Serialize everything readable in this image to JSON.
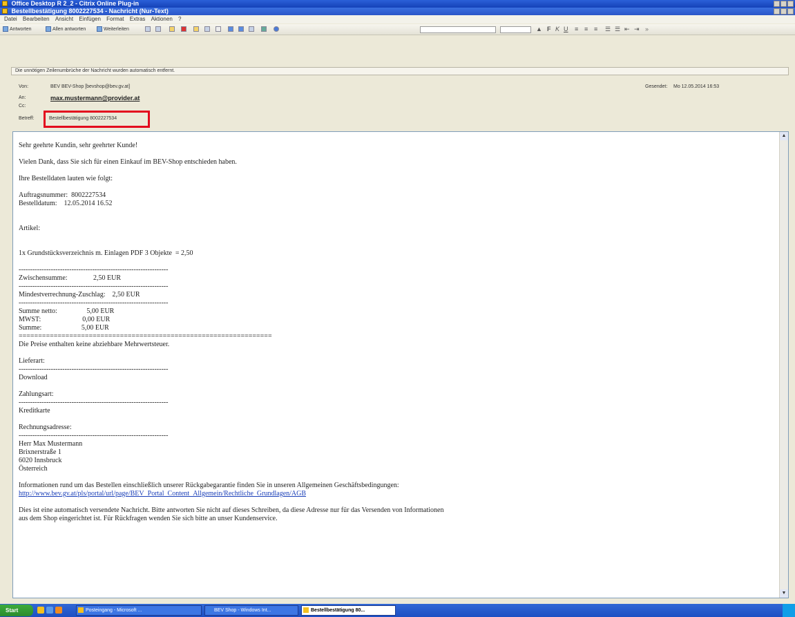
{
  "outer_window": {
    "title": "Office Desktop R 2_2 - Citrix Online Plug-in"
  },
  "message_window": {
    "title": "Bestellbestätigung 8002227534 - Nachricht (Nur-Text)"
  },
  "menu": [
    "Datei",
    "Bearbeiten",
    "Ansicht",
    "Einfügen",
    "Format",
    "Extras",
    "Aktionen",
    "?"
  ],
  "toolbar": {
    "reply": "Antworten",
    "reply_all": "Allen antworten",
    "forward": "Weiterleiten"
  },
  "info_bar": "Die unnötigen Zeilenumbrüche der Nachricht wurden automatisch entfernt.",
  "header": {
    "from_label": "Von:",
    "from_value": "BEV BEV-Shop [bevshop@bev.gv.at]",
    "to_label": "An:",
    "to_value": "max.mustermann@provider.at",
    "cc_label": "Cc:",
    "subject_label": "Betreff:",
    "subject_value": "Bestellbestätigung 8002227534",
    "sent_label": "Gesendet:",
    "sent_value": "Mo 12.05.2014 16:53"
  },
  "body": {
    "greeting": "Sehr geehrte Kundin, sehr geehrter Kunde!",
    "thanks": "Vielen Dank, dass Sie sich für einen Einkauf im BEV-Shop entschieden haben.",
    "intro": "Ihre Bestelldaten lauten wie folgt:",
    "order_number": "Auftragsnummer:  8002227534",
    "order_date": "Bestelldatum:    12.05.2014 16.52",
    "articles_heading": "Artikel:",
    "article_line": "1x Grundstücksverzeichnis m. Einlagen PDF 3 Objekte  = 2,50",
    "divider": "-----------------------------------------------------------------",
    "subtotal": "Zwischensumme:               2,50 EUR",
    "min_charge": "Mindestverrechnung-Zuschlag:    2,50 EUR",
    "net_sum": "Summe netto:                 5,00 EUR",
    "vat": "MWST:                        0,00 EUR",
    "total": "Summe:                       5,00 EUR",
    "double_divider": "=================================================================",
    "vat_note": "Die Preise enthalten keine abziehbare Mehrwertsteuer.",
    "delivery_label": "Lieferart:",
    "delivery_value": "Download",
    "payment_label": "Zahlungsart:",
    "payment_value": "Kreditkarte",
    "billing_label": "Rechnungsadresse:",
    "address_name": "Herr Max Mustermann",
    "address_street": "Brixnerstraße 1",
    "address_city": "6020 Innsbruck",
    "address_country": "Österreich",
    "terms_text": "Informationen rund um das Bestellen einschließlich unserer Rückgabegarantie finden Sie in unseren Allgemeinen Geschäftsbedingungen:",
    "terms_link": "http://www.bev.gv.at/pls/portal/url/page/BEV_Portal_Content_Allgemein/Rechtliche_Grundlagen/AGB",
    "auto_note_1": "Dies ist eine automatisch versendete Nachricht. Bitte antworten Sie nicht auf dieses Schreiben, da diese Adresse nur für das Versenden von Informationen",
    "auto_note_2": "aus dem Shop eingerichtet ist. Für Rückfragen wenden Sie sich bitte an unser Kundenservice."
  },
  "taskbar": {
    "start": "Start",
    "task_1": "Posteingang - Microsoft ...",
    "task_2": "BEV Shop - Windows Int...",
    "task_3": "Bestellbestätigung 80..."
  }
}
